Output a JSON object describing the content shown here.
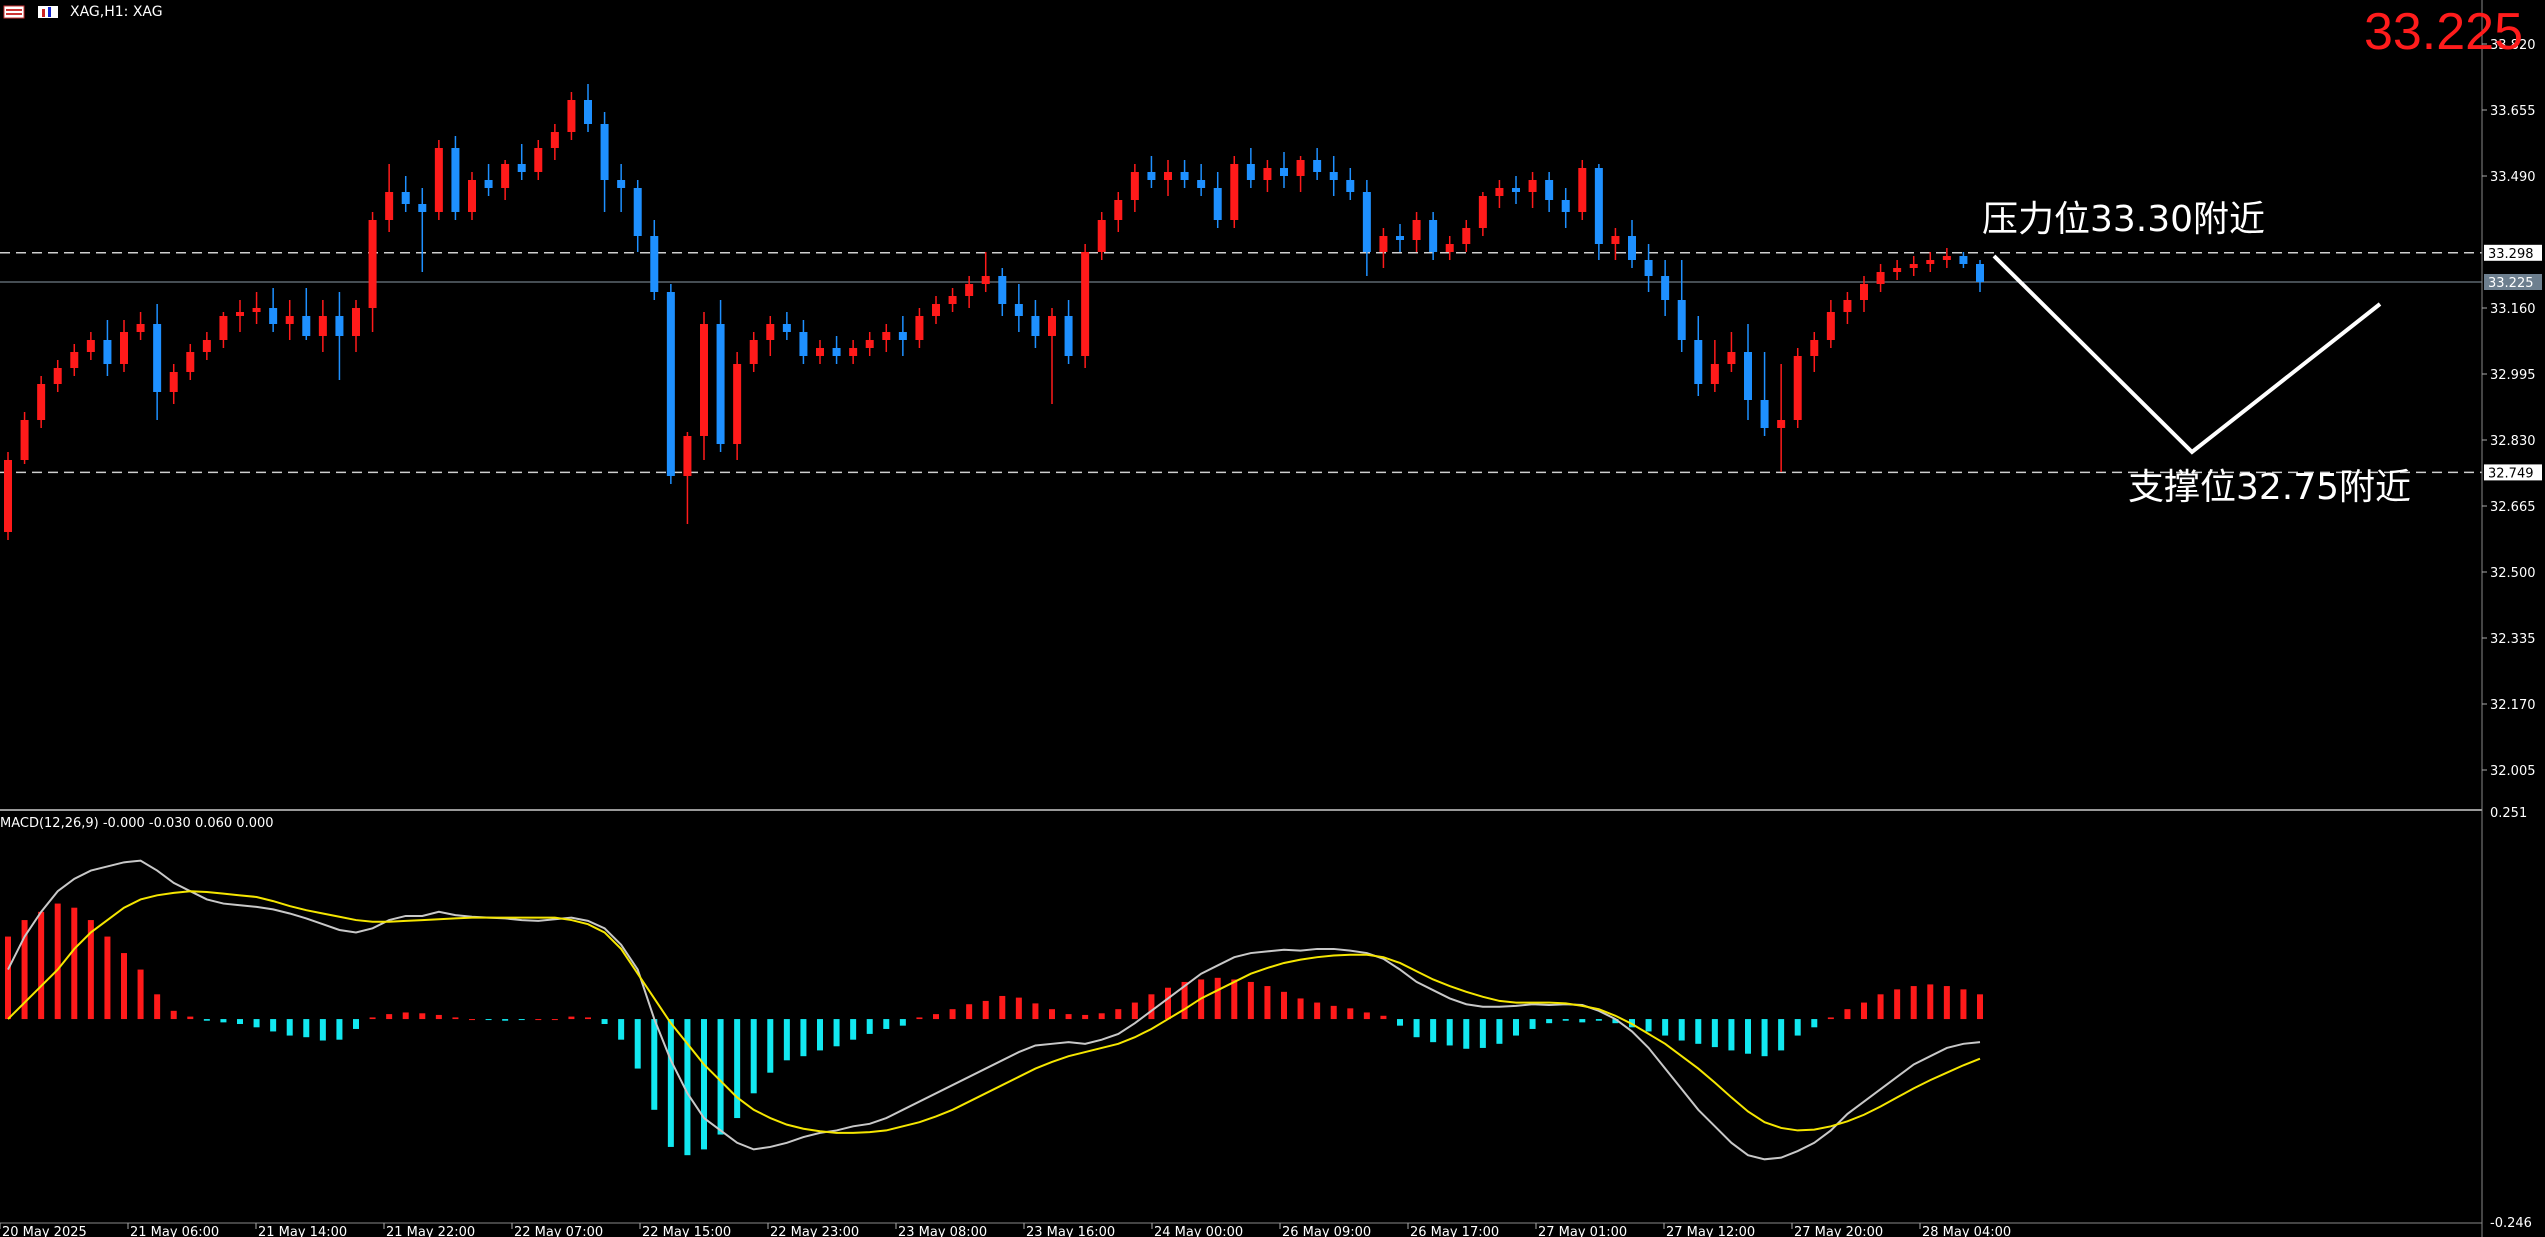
{
  "header": {
    "symbol_info": "XAG,H1:  XAG",
    "icons": [
      "menu-icon",
      "chart-type-icon"
    ]
  },
  "current_price": "33.225",
  "annotations": {
    "resistance_label": "压力位33.30附近",
    "support_label": "支撑位32.75附近"
  },
  "colors": {
    "bull": "#ff1a1a",
    "bear": "#1e90ff",
    "macd_pos": "#ff1a1a",
    "macd_neg": "#12e8f0",
    "macd_line": "#c8c8c8",
    "signal_line": "#f5e600",
    "price_text": "#ff1c1c"
  },
  "price_axis": {
    "labels": [
      "33.820",
      "33.655",
      "33.490",
      "33.160",
      "32.995",
      "32.830",
      "32.665",
      "32.500",
      "32.335",
      "32.170",
      "32.005"
    ],
    "resistance_tag": "33.298",
    "bid_tag": "33.225",
    "support_tag": "32.749"
  },
  "macd_panel": {
    "label": "MACD(12,26,9) -0.000 -0.030 0.060 0.000",
    "axis_top": "0.251",
    "axis_bottom": "-0.246"
  },
  "time_axis": {
    "labels": [
      "20 May 2025",
      "21 May 06:00",
      "21 May 14:00",
      "21 May 22:00",
      "22 May 07:00",
      "22 May 15:00",
      "22 May 23:00",
      "23 May 08:00",
      "23 May 16:00",
      "24 May 00:00",
      "26 May 09:00",
      "26 May 17:00",
      "27 May 01:00",
      "27 May 12:00",
      "27 May 20:00",
      "28 May 04:00"
    ]
  },
  "chart_data": {
    "type": "candlestick",
    "price_ylim": [
      31.91,
      33.93
    ],
    "resistance": 33.298,
    "support": 32.749,
    "last": 33.225,
    "candles": [
      [
        32.6,
        32.8,
        32.58,
        32.78
      ],
      [
        32.78,
        32.9,
        32.77,
        32.88
      ],
      [
        32.88,
        32.99,
        32.86,
        32.97
      ],
      [
        32.97,
        33.03,
        32.95,
        33.01
      ],
      [
        33.01,
        33.07,
        32.99,
        33.05
      ],
      [
        33.05,
        33.1,
        33.03,
        33.08
      ],
      [
        33.08,
        33.13,
        32.99,
        33.02
      ],
      [
        33.02,
        33.13,
        33.0,
        33.1
      ],
      [
        33.1,
        33.15,
        33.08,
        33.12
      ],
      [
        33.12,
        33.17,
        32.88,
        32.95
      ],
      [
        32.95,
        33.02,
        32.92,
        33.0
      ],
      [
        33.0,
        33.07,
        32.98,
        33.05
      ],
      [
        33.05,
        33.1,
        33.03,
        33.08
      ],
      [
        33.08,
        33.15,
        33.06,
        33.14
      ],
      [
        33.14,
        33.18,
        33.1,
        33.15
      ],
      [
        33.15,
        33.2,
        33.12,
        33.16
      ],
      [
        33.16,
        33.21,
        33.1,
        33.12
      ],
      [
        33.12,
        33.18,
        33.08,
        33.14
      ],
      [
        33.14,
        33.21,
        33.08,
        33.09
      ],
      [
        33.09,
        33.18,
        33.05,
        33.14
      ],
      [
        33.14,
        33.2,
        32.98,
        33.09
      ],
      [
        33.09,
        33.18,
        33.05,
        33.16
      ],
      [
        33.16,
        33.4,
        33.1,
        33.38
      ],
      [
        33.38,
        33.52,
        33.35,
        33.45
      ],
      [
        33.45,
        33.49,
        33.4,
        33.42
      ],
      [
        33.42,
        33.46,
        33.25,
        33.4
      ],
      [
        33.4,
        33.58,
        33.38,
        33.56
      ],
      [
        33.56,
        33.59,
        33.38,
        33.4
      ],
      [
        33.4,
        33.5,
        33.38,
        33.48
      ],
      [
        33.48,
        33.52,
        33.44,
        33.46
      ],
      [
        33.46,
        33.53,
        33.43,
        33.52
      ],
      [
        33.52,
        33.57,
        33.48,
        33.5
      ],
      [
        33.5,
        33.58,
        33.48,
        33.56
      ],
      [
        33.56,
        33.62,
        33.53,
        33.6
      ],
      [
        33.6,
        33.7,
        33.58,
        33.68
      ],
      [
        33.68,
        33.72,
        33.6,
        33.62
      ],
      [
        33.62,
        33.65,
        33.4,
        33.48
      ],
      [
        33.48,
        33.52,
        33.4,
        33.46
      ],
      [
        33.46,
        33.48,
        33.3,
        33.34
      ],
      [
        33.34,
        33.38,
        33.18,
        33.2
      ],
      [
        33.2,
        33.22,
        32.72,
        32.74
      ],
      [
        32.74,
        32.85,
        32.62,
        32.84
      ],
      [
        32.84,
        33.15,
        32.78,
        33.12
      ],
      [
        33.12,
        33.18,
        32.8,
        32.82
      ],
      [
        32.82,
        33.05,
        32.78,
        33.02
      ],
      [
        33.02,
        33.1,
        33.0,
        33.08
      ],
      [
        33.08,
        33.14,
        33.04,
        33.12
      ],
      [
        33.12,
        33.15,
        33.08,
        33.1
      ],
      [
        33.1,
        33.13,
        33.02,
        33.04
      ],
      [
        33.04,
        33.08,
        33.02,
        33.06
      ],
      [
        33.06,
        33.09,
        33.02,
        33.04
      ],
      [
        33.04,
        33.08,
        33.02,
        33.06
      ],
      [
        33.06,
        33.1,
        33.04,
        33.08
      ],
      [
        33.08,
        33.12,
        33.05,
        33.1
      ],
      [
        33.1,
        33.14,
        33.04,
        33.08
      ],
      [
        33.08,
        33.16,
        33.06,
        33.14
      ],
      [
        33.14,
        33.19,
        33.12,
        33.17
      ],
      [
        33.17,
        33.21,
        33.15,
        33.19
      ],
      [
        33.19,
        33.24,
        33.16,
        33.22
      ],
      [
        33.22,
        33.3,
        33.2,
        33.24
      ],
      [
        33.24,
        33.26,
        33.14,
        33.17
      ],
      [
        33.17,
        33.22,
        33.1,
        33.14
      ],
      [
        33.14,
        33.18,
        33.06,
        33.09
      ],
      [
        33.09,
        33.16,
        32.92,
        33.14
      ],
      [
        33.14,
        33.18,
        33.02,
        33.04
      ],
      [
        33.04,
        33.32,
        33.01,
        33.3
      ],
      [
        33.3,
        33.4,
        33.28,
        33.38
      ],
      [
        33.38,
        33.45,
        33.35,
        33.43
      ],
      [
        33.43,
        33.52,
        33.4,
        33.5
      ],
      [
        33.5,
        33.54,
        33.46,
        33.48
      ],
      [
        33.48,
        33.53,
        33.44,
        33.5
      ],
      [
        33.5,
        33.53,
        33.46,
        33.48
      ],
      [
        33.48,
        33.52,
        33.44,
        33.46
      ],
      [
        33.46,
        33.5,
        33.36,
        33.38
      ],
      [
        33.38,
        33.54,
        33.36,
        33.52
      ],
      [
        33.52,
        33.56,
        33.46,
        33.48
      ],
      [
        33.48,
        33.53,
        33.45,
        33.51
      ],
      [
        33.51,
        33.55,
        33.46,
        33.49
      ],
      [
        33.49,
        33.54,
        33.45,
        33.53
      ],
      [
        33.53,
        33.56,
        33.48,
        33.5
      ],
      [
        33.5,
        33.54,
        33.44,
        33.48
      ],
      [
        33.48,
        33.51,
        33.43,
        33.45
      ],
      [
        33.45,
        33.48,
        33.24,
        33.3
      ],
      [
        33.3,
        33.36,
        33.26,
        33.34
      ],
      [
        33.34,
        33.37,
        33.3,
        33.33
      ],
      [
        33.33,
        33.4,
        33.3,
        33.38
      ],
      [
        33.38,
        33.4,
        33.28,
        33.3
      ],
      [
        33.3,
        33.34,
        33.28,
        33.32
      ],
      [
        33.32,
        33.38,
        33.3,
        33.36
      ],
      [
        33.36,
        33.45,
        33.34,
        33.44
      ],
      [
        33.44,
        33.48,
        33.41,
        33.46
      ],
      [
        33.46,
        33.49,
        33.42,
        33.45
      ],
      [
        33.45,
        33.5,
        33.41,
        33.48
      ],
      [
        33.48,
        33.5,
        33.4,
        33.43
      ],
      [
        33.43,
        33.46,
        33.36,
        33.4
      ],
      [
        33.4,
        33.53,
        33.38,
        33.51
      ],
      [
        33.51,
        33.52,
        33.28,
        33.32
      ],
      [
        33.32,
        33.36,
        33.28,
        33.34
      ],
      [
        33.34,
        33.38,
        33.26,
        33.28
      ],
      [
        33.28,
        33.32,
        33.2,
        33.24
      ],
      [
        33.24,
        33.28,
        33.14,
        33.18
      ],
      [
        33.18,
        33.28,
        33.05,
        33.08
      ],
      [
        33.08,
        33.14,
        32.94,
        32.97
      ],
      [
        32.97,
        33.08,
        32.95,
        33.02
      ],
      [
        33.02,
        33.1,
        33.0,
        33.05
      ],
      [
        33.05,
        33.12,
        32.88,
        32.93
      ],
      [
        32.93,
        33.05,
        32.84,
        32.86
      ],
      [
        32.86,
        33.02,
        32.75,
        32.88
      ],
      [
        32.88,
        33.06,
        32.86,
        33.04
      ],
      [
        33.04,
        33.1,
        33.0,
        33.08
      ],
      [
        33.08,
        33.18,
        33.06,
        33.15
      ],
      [
        33.15,
        33.2,
        33.12,
        33.18
      ],
      [
        33.18,
        33.24,
        33.15,
        33.22
      ],
      [
        33.22,
        33.27,
        33.2,
        33.25
      ],
      [
        33.25,
        33.28,
        33.23,
        33.26
      ],
      [
        33.26,
        33.29,
        33.24,
        33.27
      ],
      [
        33.27,
        33.3,
        33.25,
        33.28
      ],
      [
        33.28,
        33.31,
        33.26,
        33.29
      ],
      [
        33.29,
        33.3,
        33.26,
        33.27
      ],
      [
        33.27,
        33.28,
        33.2,
        33.225
      ]
    ],
    "macd_ylim": [
      -0.246,
      0.251
    ],
    "macd_hist": [
      0.1,
      0.12,
      0.13,
      0.14,
      0.135,
      0.12,
      0.1,
      0.08,
      0.06,
      0.03,
      0.01,
      0.003,
      -0.002,
      -0.004,
      -0.006,
      -0.01,
      -0.015,
      -0.02,
      -0.022,
      -0.026,
      -0.025,
      -0.012,
      0.002,
      0.006,
      0.008,
      0.007,
      0.005,
      0.002,
      0.0,
      -0.001,
      -0.002,
      -0.001,
      0.0,
      0.0,
      0.003,
      0.002,
      -0.006,
      -0.025,
      -0.06,
      -0.11,
      -0.155,
      -0.165,
      -0.158,
      -0.14,
      -0.12,
      -0.09,
      -0.065,
      -0.05,
      -0.045,
      -0.038,
      -0.033,
      -0.025,
      -0.018,
      -0.012,
      -0.008,
      0.002,
      0.006,
      0.012,
      0.018,
      0.022,
      0.028,
      0.026,
      0.019,
      0.012,
      0.006,
      0.005,
      0.007,
      0.012,
      0.02,
      0.03,
      0.038,
      0.045,
      0.048,
      0.05,
      0.048,
      0.045,
      0.04,
      0.033,
      0.025,
      0.02,
      0.016,
      0.013,
      0.008,
      0.004,
      -0.008,
      -0.022,
      -0.028,
      -0.032,
      -0.036,
      -0.035,
      -0.03,
      -0.02,
      -0.012,
      -0.005,
      -0.002,
      -0.004,
      -0.002,
      -0.005,
      -0.01,
      -0.015,
      -0.02,
      -0.026,
      -0.03,
      -0.034,
      -0.038,
      -0.042,
      -0.045,
      -0.038,
      -0.02,
      -0.01,
      0.002,
      0.012,
      0.02,
      0.03,
      0.036,
      0.04,
      0.042,
      0.04,
      0.036,
      0.03
    ],
    "macd_line": [
      0.06,
      0.1,
      0.13,
      0.155,
      0.17,
      0.18,
      0.185,
      0.19,
      0.192,
      0.18,
      0.165,
      0.155,
      0.145,
      0.14,
      0.138,
      0.136,
      0.133,
      0.128,
      0.122,
      0.115,
      0.108,
      0.105,
      0.11,
      0.12,
      0.125,
      0.125,
      0.13,
      0.126,
      0.124,
      0.123,
      0.122,
      0.12,
      0.119,
      0.121,
      0.123,
      0.119,
      0.11,
      0.09,
      0.06,
      0.0,
      -0.05,
      -0.09,
      -0.12,
      -0.135,
      -0.15,
      -0.158,
      -0.155,
      -0.15,
      -0.143,
      -0.138,
      -0.135,
      -0.13,
      -0.127,
      -0.12,
      -0.11,
      -0.1,
      -0.09,
      -0.08,
      -0.07,
      -0.06,
      -0.05,
      -0.04,
      -0.032,
      -0.03,
      -0.028,
      -0.03,
      -0.025,
      -0.018,
      -0.005,
      0.01,
      0.025,
      0.04,
      0.055,
      0.065,
      0.075,
      0.08,
      0.082,
      0.084,
      0.083,
      0.085,
      0.085,
      0.083,
      0.08,
      0.073,
      0.06,
      0.045,
      0.035,
      0.025,
      0.018,
      0.015,
      0.015,
      0.016,
      0.018,
      0.017,
      0.018,
      0.017,
      0.01,
      0.0,
      -0.015,
      -0.035,
      -0.06,
      -0.085,
      -0.11,
      -0.13,
      -0.15,
      -0.165,
      -0.17,
      -0.168,
      -0.16,
      -0.15,
      -0.135,
      -0.115,
      -0.1,
      -0.085,
      -0.07,
      -0.055,
      -0.045,
      -0.035,
      -0.03,
      -0.028
    ],
    "signal_line": [
      0.0,
      0.02,
      0.04,
      0.06,
      0.085,
      0.105,
      0.12,
      0.135,
      0.145,
      0.15,
      0.153,
      0.155,
      0.154,
      0.152,
      0.15,
      0.148,
      0.143,
      0.137,
      0.132,
      0.128,
      0.124,
      0.12,
      0.118,
      0.118,
      0.119,
      0.12,
      0.121,
      0.122,
      0.123,
      0.123,
      0.123,
      0.123,
      0.123,
      0.123,
      0.12,
      0.115,
      0.105,
      0.085,
      0.055,
      0.025,
      -0.005,
      -0.03,
      -0.055,
      -0.075,
      -0.095,
      -0.11,
      -0.12,
      -0.128,
      -0.133,
      -0.136,
      -0.138,
      -0.138,
      -0.137,
      -0.135,
      -0.13,
      -0.125,
      -0.118,
      -0.11,
      -0.1,
      -0.09,
      -0.08,
      -0.07,
      -0.06,
      -0.052,
      -0.045,
      -0.04,
      -0.035,
      -0.03,
      -0.022,
      -0.012,
      0.0,
      0.012,
      0.025,
      0.035,
      0.045,
      0.055,
      0.062,
      0.068,
      0.072,
      0.075,
      0.077,
      0.078,
      0.078,
      0.075,
      0.068,
      0.058,
      0.048,
      0.04,
      0.033,
      0.027,
      0.022,
      0.02,
      0.02,
      0.02,
      0.019,
      0.016,
      0.012,
      0.004,
      -0.006,
      -0.018,
      -0.03,
      -0.045,
      -0.06,
      -0.077,
      -0.095,
      -0.112,
      -0.125,
      -0.132,
      -0.135,
      -0.134,
      -0.13,
      -0.124,
      -0.116,
      -0.106,
      -0.095,
      -0.084,
      -0.074,
      -0.065,
      -0.056,
      -0.048
    ]
  }
}
